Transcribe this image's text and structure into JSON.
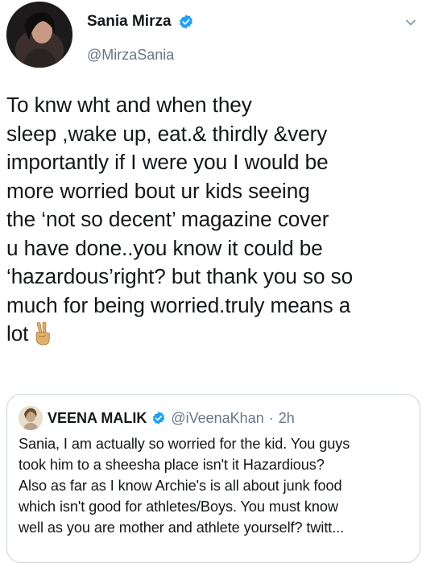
{
  "tweet": {
    "author": {
      "name": "Sania Mirza",
      "handle": "@MirzaSania",
      "avatar_icon": "profile-photo",
      "verified_icon": "verified-badge-icon"
    },
    "text_lines": [
      "To knw wht and when they",
      "sleep ,wake up, eat.& thirdly &very",
      "importantly if I were you I would be",
      "more worried bout ur kids seeing",
      "the ‘not so decent’ magazine cover",
      "u have done..you know it could be",
      "‘hazardous’right? but thank you so so",
      "much for being worried.truly means a",
      "lot"
    ],
    "trailing_emoji": "victory-hand-emoji"
  },
  "quoted_tweet": {
    "author": {
      "name": "VEENA MALIK",
      "handle": "@iVeenaKhan",
      "separator": "·",
      "time": "2h"
    },
    "text_lines": [
      "Sania, I am actually so worried for the kid. You guys",
      "took him to a sheesha place isn't it Hazardious?",
      "Also as far as I know Archie's is all about junk food",
      "which isn't good for athletes/Boys. You must know",
      "well as you are mother and athlete yourself? twitt..."
    ]
  },
  "colors": {
    "verified_blue": "#1da1f2",
    "secondary_text": "#657786",
    "border": "#ccd6dd"
  }
}
